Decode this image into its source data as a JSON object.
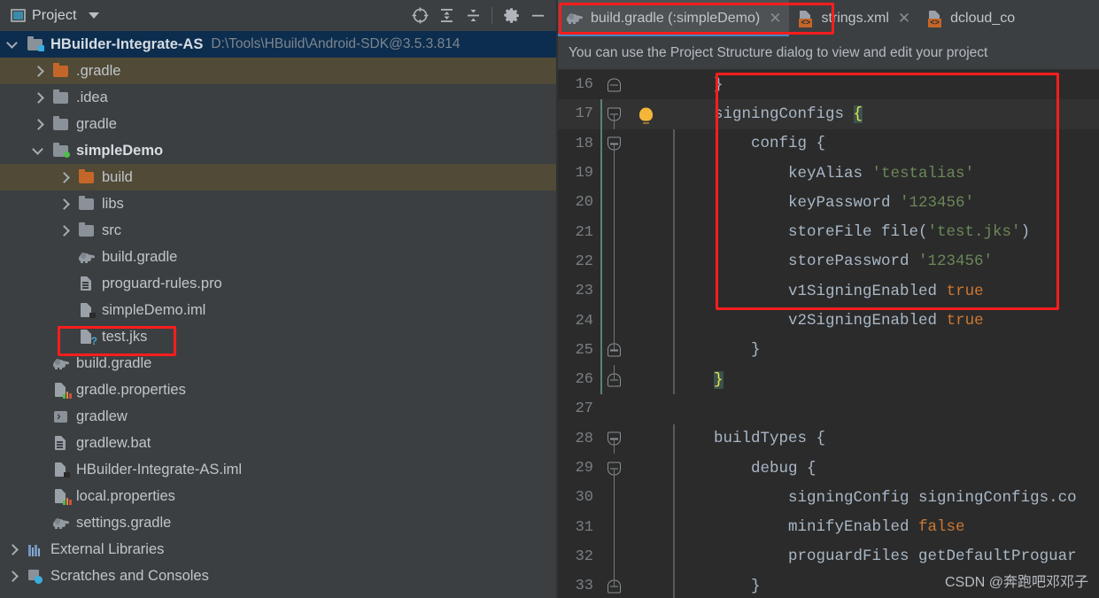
{
  "project_panel": {
    "title": "Project",
    "title_icon": "project-window-icon",
    "dropdown_icon": "chevron-down-icon",
    "toolbar_buttons": [
      {
        "name": "select-opened-file-icon",
        "label": ""
      },
      {
        "name": "expand-all-icon",
        "label": ""
      },
      {
        "name": "collapse-all-icon",
        "label": ""
      },
      {
        "name": "settings-gear-icon",
        "label": ""
      },
      {
        "name": "hide-panel-icon",
        "label": ""
      }
    ],
    "tree": [
      {
        "label": "HBuilder-Integrate-AS",
        "sublabel": "D:\\Tools\\HBuild\\Android-SDK@3.5.3.814",
        "indent": 0,
        "twisty": "open",
        "icon": "module-folder-icon",
        "state": "selected-root",
        "bold": true
      },
      {
        "label": ".gradle",
        "sublabel": "",
        "indent": 1,
        "twisty": "closed",
        "icon": "excluded-folder-icon",
        "state": "excluded"
      },
      {
        "label": ".idea",
        "sublabel": "",
        "indent": 1,
        "twisty": "closed",
        "icon": "folder-icon",
        "state": "normal"
      },
      {
        "label": "gradle",
        "sublabel": "",
        "indent": 1,
        "twisty": "closed",
        "icon": "folder-icon",
        "state": "normal"
      },
      {
        "label": "simpleDemo",
        "sublabel": "",
        "indent": 1,
        "twisty": "open",
        "icon": "module-folder-icon",
        "state": "normal",
        "bold": true
      },
      {
        "label": "build",
        "sublabel": "",
        "indent": 2,
        "twisty": "closed",
        "icon": "excluded-folder-icon",
        "state": "excluded"
      },
      {
        "label": "libs",
        "sublabel": "",
        "indent": 2,
        "twisty": "closed",
        "icon": "folder-icon",
        "state": "normal"
      },
      {
        "label": "src",
        "sublabel": "",
        "indent": 2,
        "twisty": "closed",
        "icon": "folder-icon",
        "state": "normal"
      },
      {
        "label": "build.gradle",
        "sublabel": "",
        "indent": 2,
        "twisty": "none",
        "icon": "gradle-file-icon",
        "state": "normal"
      },
      {
        "label": "proguard-rules.pro",
        "sublabel": "",
        "indent": 2,
        "twisty": "none",
        "icon": "text-file-icon",
        "state": "normal"
      },
      {
        "label": "simpleDemo.iml",
        "sublabel": "",
        "indent": 2,
        "twisty": "none",
        "icon": "iml-file-icon",
        "state": "normal"
      },
      {
        "label": "test.jks",
        "sublabel": "",
        "indent": 2,
        "twisty": "none",
        "icon": "unknown-file-icon",
        "state": "normal",
        "highlighted": true
      },
      {
        "label": "build.gradle",
        "sublabel": "",
        "indent": 1,
        "twisty": "none",
        "icon": "gradle-file-icon",
        "state": "normal"
      },
      {
        "label": "gradle.properties",
        "sublabel": "",
        "indent": 1,
        "twisty": "none",
        "icon": "properties-file-icon",
        "state": "normal"
      },
      {
        "label": "gradlew",
        "sublabel": "",
        "indent": 1,
        "twisty": "none",
        "icon": "shell-script-icon",
        "state": "normal"
      },
      {
        "label": "gradlew.bat",
        "sublabel": "",
        "indent": 1,
        "twisty": "none",
        "icon": "text-file-icon",
        "state": "normal"
      },
      {
        "label": "HBuilder-Integrate-AS.iml",
        "sublabel": "",
        "indent": 1,
        "twisty": "none",
        "icon": "iml-file-icon",
        "state": "normal"
      },
      {
        "label": "local.properties",
        "sublabel": "",
        "indent": 1,
        "twisty": "none",
        "icon": "properties-file-icon",
        "state": "normal"
      },
      {
        "label": "settings.gradle",
        "sublabel": "",
        "indent": 1,
        "twisty": "none",
        "icon": "gradle-file-icon",
        "state": "normal"
      },
      {
        "label": "External Libraries",
        "sublabel": "",
        "indent": 0,
        "twisty": "closed",
        "icon": "external-libraries-icon",
        "state": "normal"
      },
      {
        "label": "Scratches and Consoles",
        "sublabel": "",
        "indent": 0,
        "twisty": "closed",
        "icon": "scratches-icon",
        "state": "normal"
      }
    ]
  },
  "editor": {
    "tabs": [
      {
        "label": "build.gradle (:simpleDemo)",
        "icon": "gradle-file-icon",
        "active": true,
        "close_icon": "close-icon",
        "highlighted": true
      },
      {
        "label": "strings.xml",
        "icon": "xml-file-icon",
        "active": false,
        "close_icon": "close-icon"
      },
      {
        "label": "dcloud_co",
        "icon": "xml-file-icon",
        "active": false,
        "close_icon": "close-icon"
      }
    ],
    "notification": "You can use the Project Structure dialog to view and edit your project",
    "code_lines": [
      {
        "num": "16",
        "fold": "end",
        "bulb": false,
        "current": false,
        "indent": 0,
        "tokens": [
          {
            "t": "    ",
            "c": "plain"
          },
          {
            "t": "}",
            "c": "plain"
          }
        ]
      },
      {
        "num": "17",
        "fold": "start",
        "bulb": true,
        "current": true,
        "indent": 0,
        "tokens": [
          {
            "t": "    signingConfigs ",
            "c": "plain"
          },
          {
            "t": "{",
            "c": "brace"
          }
        ]
      },
      {
        "num": "18",
        "fold": "start",
        "bulb": false,
        "current": false,
        "indent": 0,
        "tokens": [
          {
            "t": "        config {",
            "c": "plain"
          }
        ]
      },
      {
        "num": "19",
        "fold": "none",
        "bulb": false,
        "current": false,
        "indent": 0,
        "tokens": [
          {
            "t": "            keyAlias ",
            "c": "plain"
          },
          {
            "t": "'testalias'",
            "c": "string"
          }
        ]
      },
      {
        "num": "20",
        "fold": "none",
        "bulb": false,
        "current": false,
        "indent": 0,
        "tokens": [
          {
            "t": "            keyPassword ",
            "c": "plain"
          },
          {
            "t": "'123456'",
            "c": "string"
          }
        ]
      },
      {
        "num": "21",
        "fold": "none",
        "bulb": false,
        "current": false,
        "indent": 0,
        "tokens": [
          {
            "t": "            storeFile file(",
            "c": "plain"
          },
          {
            "t": "'test.jks'",
            "c": "string"
          },
          {
            "t": ")",
            "c": "plain"
          }
        ]
      },
      {
        "num": "22",
        "fold": "none",
        "bulb": false,
        "current": false,
        "indent": 0,
        "tokens": [
          {
            "t": "            storePassword ",
            "c": "plain"
          },
          {
            "t": "'123456'",
            "c": "string"
          }
        ]
      },
      {
        "num": "23",
        "fold": "none",
        "bulb": false,
        "current": false,
        "indent": 0,
        "tokens": [
          {
            "t": "            v1SigningEnabled ",
            "c": "plain"
          },
          {
            "t": "true",
            "c": "keyword"
          }
        ]
      },
      {
        "num": "24",
        "fold": "none",
        "bulb": false,
        "current": false,
        "indent": 0,
        "tokens": [
          {
            "t": "            v2SigningEnabled ",
            "c": "plain"
          },
          {
            "t": "true",
            "c": "keyword"
          }
        ]
      },
      {
        "num": "25",
        "fold": "end",
        "bulb": false,
        "current": false,
        "indent": 0,
        "tokens": [
          {
            "t": "        }",
            "c": "plain"
          }
        ]
      },
      {
        "num": "26",
        "fold": "end",
        "bulb": false,
        "current": false,
        "indent": 0,
        "tokens": [
          {
            "t": "    ",
            "c": "plain"
          },
          {
            "t": "}",
            "c": "brace"
          }
        ]
      },
      {
        "num": "27",
        "fold": "none",
        "bulb": false,
        "current": false,
        "indent": 0,
        "tokens": [
          {
            "t": "",
            "c": "plain"
          }
        ]
      },
      {
        "num": "28",
        "fold": "start",
        "bulb": false,
        "current": false,
        "indent": 0,
        "tokens": [
          {
            "t": "    buildTypes {",
            "c": "plain"
          }
        ]
      },
      {
        "num": "29",
        "fold": "start",
        "bulb": false,
        "current": false,
        "indent": 0,
        "tokens": [
          {
            "t": "        debug {",
            "c": "plain"
          }
        ]
      },
      {
        "num": "30",
        "fold": "none",
        "bulb": false,
        "current": false,
        "indent": 0,
        "tokens": [
          {
            "t": "            signingConfig signingConfigs.co",
            "c": "plain"
          }
        ]
      },
      {
        "num": "31",
        "fold": "none",
        "bulb": false,
        "current": false,
        "indent": 0,
        "tokens": [
          {
            "t": "            minifyEnabled ",
            "c": "plain"
          },
          {
            "t": "false",
            "c": "keyword"
          }
        ]
      },
      {
        "num": "32",
        "fold": "none",
        "bulb": false,
        "current": false,
        "indent": 0,
        "tokens": [
          {
            "t": "            proguardFiles getDefaultProguar",
            "c": "plain"
          }
        ]
      },
      {
        "num": "33",
        "fold": "end",
        "bulb": false,
        "current": false,
        "indent": 0,
        "tokens": [
          {
            "t": "        }",
            "c": "plain"
          }
        ]
      }
    ]
  },
  "watermark": "CSDN @奔跑吧邓邓子",
  "colors": {
    "panel_bg": "#3c3f41",
    "editor_bg": "#2b2b2b",
    "selection_blue": "#0d2d4e",
    "excluded_olive": "#504a36",
    "annotation_red": "#fd1d1d",
    "tab_active": "#4e5254",
    "tab_underline": "#4a88c7",
    "string_green": "#6a8759",
    "keyword_orange": "#cc7832",
    "text_gray": "#a9b7c6"
  }
}
